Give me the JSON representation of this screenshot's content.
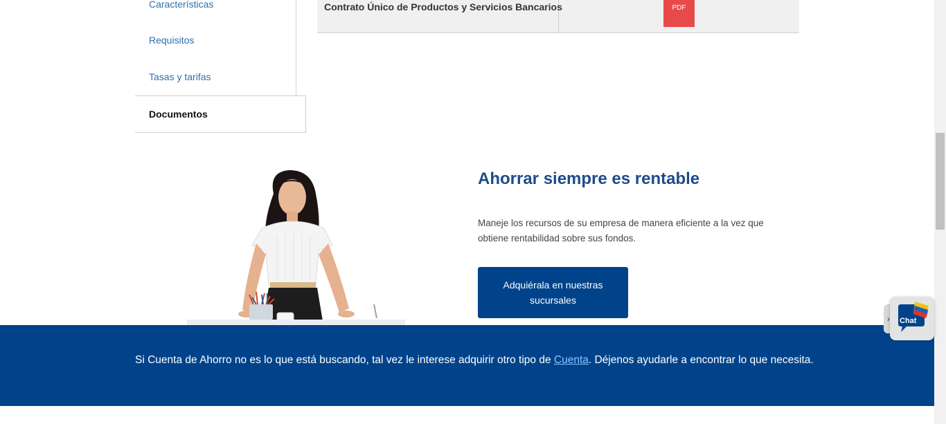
{
  "sidebar": {
    "items": [
      {
        "label": "Características"
      },
      {
        "label": "Requisitos"
      },
      {
        "label": "Tasas y tarifas"
      },
      {
        "label": "Documentos",
        "active": true
      }
    ]
  },
  "documents": {
    "rows": [
      {
        "name": "Contrato Único de Productos y Servicios Bancarios",
        "file_label": "PDF"
      }
    ]
  },
  "promo": {
    "title": "Ahorrar siempre es rentable",
    "text": "Maneje los recursos de su empresa de manera eficiente a la vez que obtiene rentabilidad sobre sus fondos.",
    "button_label": "Adquiérala en nuestras sucursales"
  },
  "banner": {
    "text_before": "Si Cuenta de Ahorro no es lo que está buscando, tal vez le interese adquirir otro tipo de ",
    "link_label": "Cuenta",
    "text_after": ". Déjenos ayudarle a encontrar lo que necesita."
  },
  "chat": {
    "label": "Chat",
    "toggle_icon": "chevron-right-icon"
  },
  "colors": {
    "brand_blue": "#00438b",
    "link_blue": "#2f6fb0",
    "title_blue": "#1e4b8a",
    "pdf_red": "#e84a4a"
  }
}
